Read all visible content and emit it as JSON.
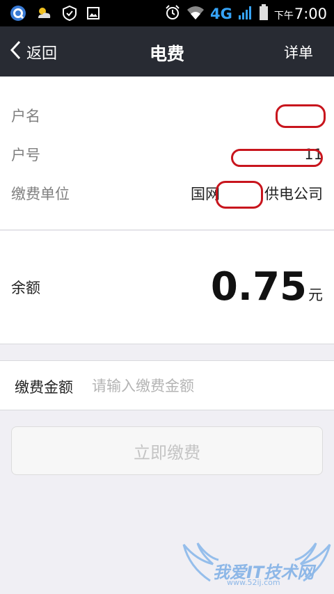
{
  "status_bar": {
    "network": "4G",
    "time_prefix": "下午",
    "time": "7:00",
    "icons": [
      "app-q-icon",
      "weather-icon",
      "security-icon",
      "image-icon",
      "alarm-icon",
      "wifi-icon",
      "signal-icon",
      "battery-icon"
    ]
  },
  "nav": {
    "back_label": "返回",
    "title": "电费",
    "detail_label": "详单"
  },
  "account_info": {
    "name_label": "户名",
    "name_value": "",
    "number_label": "户号",
    "number_value": "11",
    "unit_label": "缴费单位",
    "unit_value_prefix": "国网",
    "unit_value_suffix": "供电公司"
  },
  "balance": {
    "label": "余额",
    "amount": "0.75",
    "unit": "元"
  },
  "payment": {
    "amount_label": "缴费金额",
    "amount_placeholder": "请输入缴费金额",
    "amount_value": "",
    "button_label": "立即缴费"
  },
  "watermark": {
    "text": "我爱IT技术网",
    "url": "www.52ij.com"
  },
  "colors": {
    "nav_bg": "#282b33",
    "page_bg": "#f0eff4",
    "network_blue": "#36a3f7",
    "redaction": "#c8151d"
  }
}
